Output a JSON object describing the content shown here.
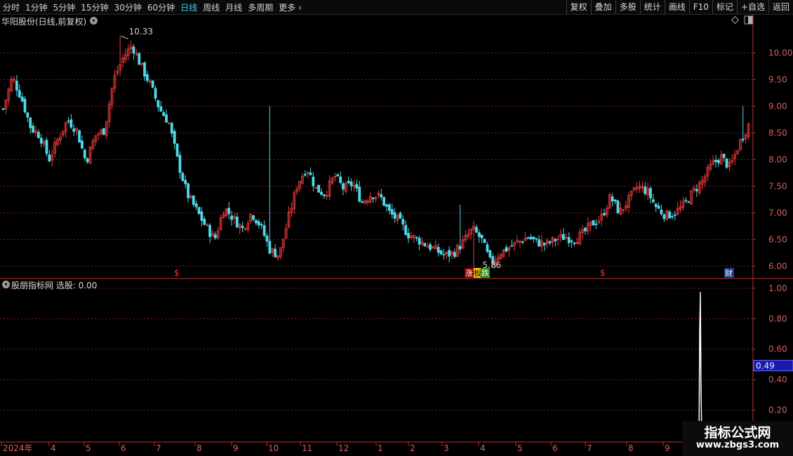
{
  "toolbar": {
    "periods": [
      "分时",
      "1分钟",
      "5分钟",
      "15分钟",
      "30分钟",
      "60分钟",
      "日线",
      "周线",
      "月线",
      "多周期",
      "更多"
    ],
    "active_period": "日线",
    "more_arrow": "›",
    "actions": [
      "复权",
      "叠加",
      "多股",
      "统计",
      "画线",
      "F10",
      "标记",
      "+自选",
      "返回"
    ]
  },
  "stock_title": "华阳股份(日线,前复权)",
  "indicator_title": "股朋指标网  选股: 0.00",
  "icons": {
    "dropdown": "chevron-down-icon",
    "diamond": "diamond-icon",
    "window": "window-toggle-icon"
  },
  "colors": {
    "up": "#f23c3c",
    "down": "#4fd8e8",
    "grid": "#7a1e1e",
    "axis": "#c03030",
    "select_box": "#1a1aa8"
  },
  "markers": {
    "high": "10.33",
    "low": "5.86",
    "event_dollar": "$",
    "event_zhang": "涨",
    "event_ban": "板",
    "event_die": "跌",
    "event_cai": "财"
  },
  "chart_data": {
    "type": "candlestick",
    "price_ticks": [
      "10.00",
      "9.50",
      "9.00",
      "8.50",
      "8.00",
      "7.50",
      "7.00",
      "6.50",
      "6.00"
    ],
    "price_range": [
      5.78,
      10.52
    ],
    "indicator_ticks": [
      "1.00",
      "0.80",
      "0.60",
      "0.40",
      "0.20"
    ],
    "indicator_range": [
      0,
      1.05
    ],
    "indicator_current": "0.49",
    "x_ticks": [
      "2024年",
      "4",
      "5",
      "6",
      "7",
      "8",
      "9",
      "10",
      "11",
      "12",
      "1",
      "2",
      "3",
      "4",
      "5",
      "6",
      "7",
      "8",
      "9"
    ],
    "close_path": [
      8.95,
      9.55,
      9.15,
      8.6,
      8.45,
      8.0,
      8.4,
      8.75,
      8.55,
      7.95,
      8.45,
      8.55,
      9.5,
      9.9,
      10.15,
      9.75,
      9.4,
      8.95,
      8.7,
      7.95,
      7.35,
      7.05,
      6.75,
      6.5,
      7.1,
      6.9,
      6.7,
      7.0,
      6.75,
      6.3,
      6.2,
      6.9,
      7.55,
      7.85,
      7.45,
      7.35,
      7.7,
      7.45,
      7.55,
      7.2,
      7.35,
      7.3,
      7.0,
      6.85,
      6.6,
      6.5,
      6.4,
      6.3,
      6.2,
      6.25,
      6.45,
      6.7,
      6.5,
      6.05,
      6.25,
      6.35,
      6.45,
      6.55,
      6.45,
      6.4,
      6.5,
      6.55,
      6.5,
      6.6,
      6.8,
      6.9,
      7.3,
      7.0,
      7.25,
      7.5,
      7.4,
      7.1,
      6.95,
      7.0,
      7.15,
      7.4,
      7.6,
      7.9,
      8.05,
      7.85,
      8.3,
      8.65
    ],
    "high_value": 10.33,
    "low_value": 5.86,
    "spike_high": 9.0
  }
}
